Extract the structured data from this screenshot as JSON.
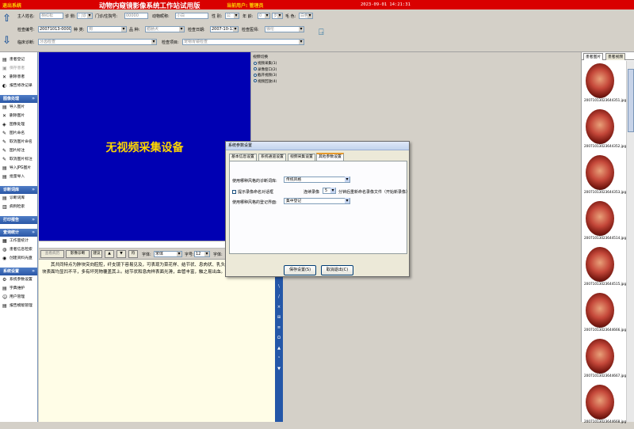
{
  "titlebar": {
    "exit_label": "退出系统",
    "title": "动物内窥镜影像系统工作站试用版",
    "current_user": "当前用户: 管理员",
    "datetime": "2023-09-01 14:21:31"
  },
  "form": {
    "row1": [
      {
        "label": "主人姓名:",
        "value": "林红松",
        "kind": "text"
      },
      {
        "label": "诊 侧:",
        "value": "门诊",
        "kind": "select"
      },
      {
        "label": "门诊/住院号:",
        "value": "00000",
        "kind": "text"
      },
      {
        "label": "动物昵称:",
        "value": "小白",
        "kind": "text"
      },
      {
        "label": "性 别:",
        "value": "公",
        "kind": "select"
      },
      {
        "label": "年 龄:",
        "value": "0",
        "kind": "select"
      },
      {
        "label": "",
        "value": "岁",
        "kind": "select"
      },
      {
        "label": "毛 色:",
        "value": "白色",
        "kind": "select"
      }
    ],
    "row2": [
      {
        "label": "检查编号:",
        "value": "20071013-000001",
        "kind": "text"
      },
      {
        "label": "种 类:",
        "value": "狗",
        "kind": "select"
      },
      {
        "label": "品 种:",
        "value": "腊肠犬",
        "kind": "select"
      },
      {
        "label": "检查日期:",
        "value": "2007-10-13",
        "kind": "date"
      },
      {
        "label": "检查医师:",
        "value": "徐伦",
        "kind": "select"
      }
    ],
    "row3": [
      {
        "label": "临床诊断:",
        "value": "牙齿检查",
        "kind": "select"
      },
      {
        "label": "检查项目:",
        "value": "宠物胃镜检查",
        "kind": "select"
      }
    ]
  },
  "sidebar": {
    "sections": [
      {
        "title": "",
        "items": [
          {
            "icon": "register-icon",
            "glyph": "▤",
            "label": "患者登记",
            "disabled": false
          },
          {
            "icon": "save-icon",
            "glyph": "▣",
            "label": "保存患者",
            "disabled": true
          },
          {
            "icon": "delete-icon",
            "glyph": "✕",
            "label": "删除患者",
            "disabled": false
          },
          {
            "icon": "history-icon",
            "glyph": "◐",
            "label": "报告修改记录",
            "disabled": false
          }
        ]
      },
      {
        "title": "图像处理",
        "items": [
          {
            "icon": "import-icon",
            "glyph": "▤",
            "label": "导入图片",
            "disabled": false
          },
          {
            "icon": "delete-image-icon",
            "glyph": "✕",
            "label": "删除图片",
            "disabled": false
          },
          {
            "icon": "image-process-icon",
            "glyph": "◈",
            "label": "图像处理",
            "disabled": false
          },
          {
            "icon": "rename-icon",
            "glyph": "✎",
            "label": "图片命名",
            "disabled": false
          },
          {
            "icon": "cancel-name-icon",
            "glyph": "✎",
            "label": "取消图片命名",
            "disabled": false
          },
          {
            "icon": "mark-icon",
            "glyph": "✎",
            "label": "图片标注",
            "disabled": false
          },
          {
            "icon": "cancel-mark-icon",
            "glyph": "✎",
            "label": "取消图片标注",
            "disabled": false
          },
          {
            "icon": "import-jpg-icon",
            "glyph": "▤",
            "label": "导入JPG图片",
            "disabled": false
          },
          {
            "icon": "batch-import-icon",
            "glyph": "▤",
            "label": "批量导入",
            "disabled": false
          }
        ]
      },
      {
        "title": "诊断词库",
        "items": [
          {
            "icon": "dictionary-icon",
            "glyph": "▤",
            "label": "诊断词库",
            "disabled": false
          },
          {
            "icon": "case-icon",
            "glyph": "▥",
            "label": "病例检索",
            "disabled": false
          }
        ]
      },
      {
        "title": "打印报告",
        "items": []
      },
      {
        "title": "查询统计",
        "items": [
          {
            "icon": "stats-icon",
            "glyph": "▦",
            "label": "工作量统计",
            "disabled": false
          },
          {
            "icon": "search-icon",
            "glyph": "◍",
            "label": "患者信息检索",
            "disabled": false
          },
          {
            "icon": "disc-icon",
            "glyph": "◉",
            "label": "创建资料光盘",
            "disabled": false
          }
        ]
      },
      {
        "title": "系统设置",
        "items": [
          {
            "icon": "settings-icon",
            "glyph": "⚙",
            "label": "系统参数设置",
            "disabled": false
          },
          {
            "icon": "dict-maintain-icon",
            "glyph": "▤",
            "label": "字典维护",
            "disabled": false
          },
          {
            "icon": "user-icon",
            "glyph": "☺",
            "label": "用户管理",
            "disabled": false
          },
          {
            "icon": "template-icon",
            "glyph": "▤",
            "label": "报告模版管理",
            "disabled": false
          }
        ]
      }
    ]
  },
  "video": {
    "no_device": "无视频采集设备"
  },
  "video_switch": {
    "title": "视频切换",
    "options": [
      "视频采集(1)",
      "录像窗口(2)",
      "截开视频(3)",
      "视频回放(4)"
    ]
  },
  "report": {
    "toolbar": {
      "buttons": [
        "查看病历",
        "影像诊断",
        "建议",
        "▲",
        "▼",
        "符"
      ],
      "font_label": "字体:",
      "font_value": "宋体",
      "size_label": "字号:",
      "size_value": "12",
      "color_label": "字体:"
    },
    "text": "　　其共同特点为肿块突向腔腔，纤支镜下容易见及，可表现为菜花样、结节状、息肉状、乳头状或块状等。菜花样肿块表面均显凹不平，多有坏死物覆盖其上。结节状和息肉样表面光滑，血管丰富，触之易出血。肿块型大多属管内型。"
  },
  "vtoolbar": [
    "A",
    "B",
    "I",
    "U",
    "\\",
    "/",
    "×",
    "⊞",
    "≡",
    "Ω",
    "▲",
    "¹",
    "▼"
  ],
  "thumbs": {
    "tabs": [
      "患者图片",
      "患者视频"
    ],
    "items": [
      "20071013023644351.jpg",
      "20071013023644352.jpg",
      "20071013023644353.jpg",
      "20071013023644514.jpg",
      "20071013023644515.jpg",
      "20071013023644666.jpg",
      "20071013023644667.jpg",
      "20071013023644668.jpg"
    ]
  },
  "dialog": {
    "title": "系统参数设置",
    "tabs": [
      "基本信息设置",
      "系统通道设置",
      "视频采集设置",
      "其他参数设置"
    ],
    "active_tab": 3,
    "diag_label": "使用哪种风格的诊断词库:",
    "diag_value": "传统风格",
    "show_record_label": "提示录像命名对话框",
    "show_record_checked": false,
    "record_prefix": "连续录像",
    "record_minutes": "5",
    "record_suffix": "分钟后重新命名录像文件（开始新录像）",
    "entry_label": "使用哪种风格的登记界面:",
    "entry_value": "集中登记",
    "save_button": "保存设置(S)",
    "cancel_button": "取消退出(C)"
  }
}
